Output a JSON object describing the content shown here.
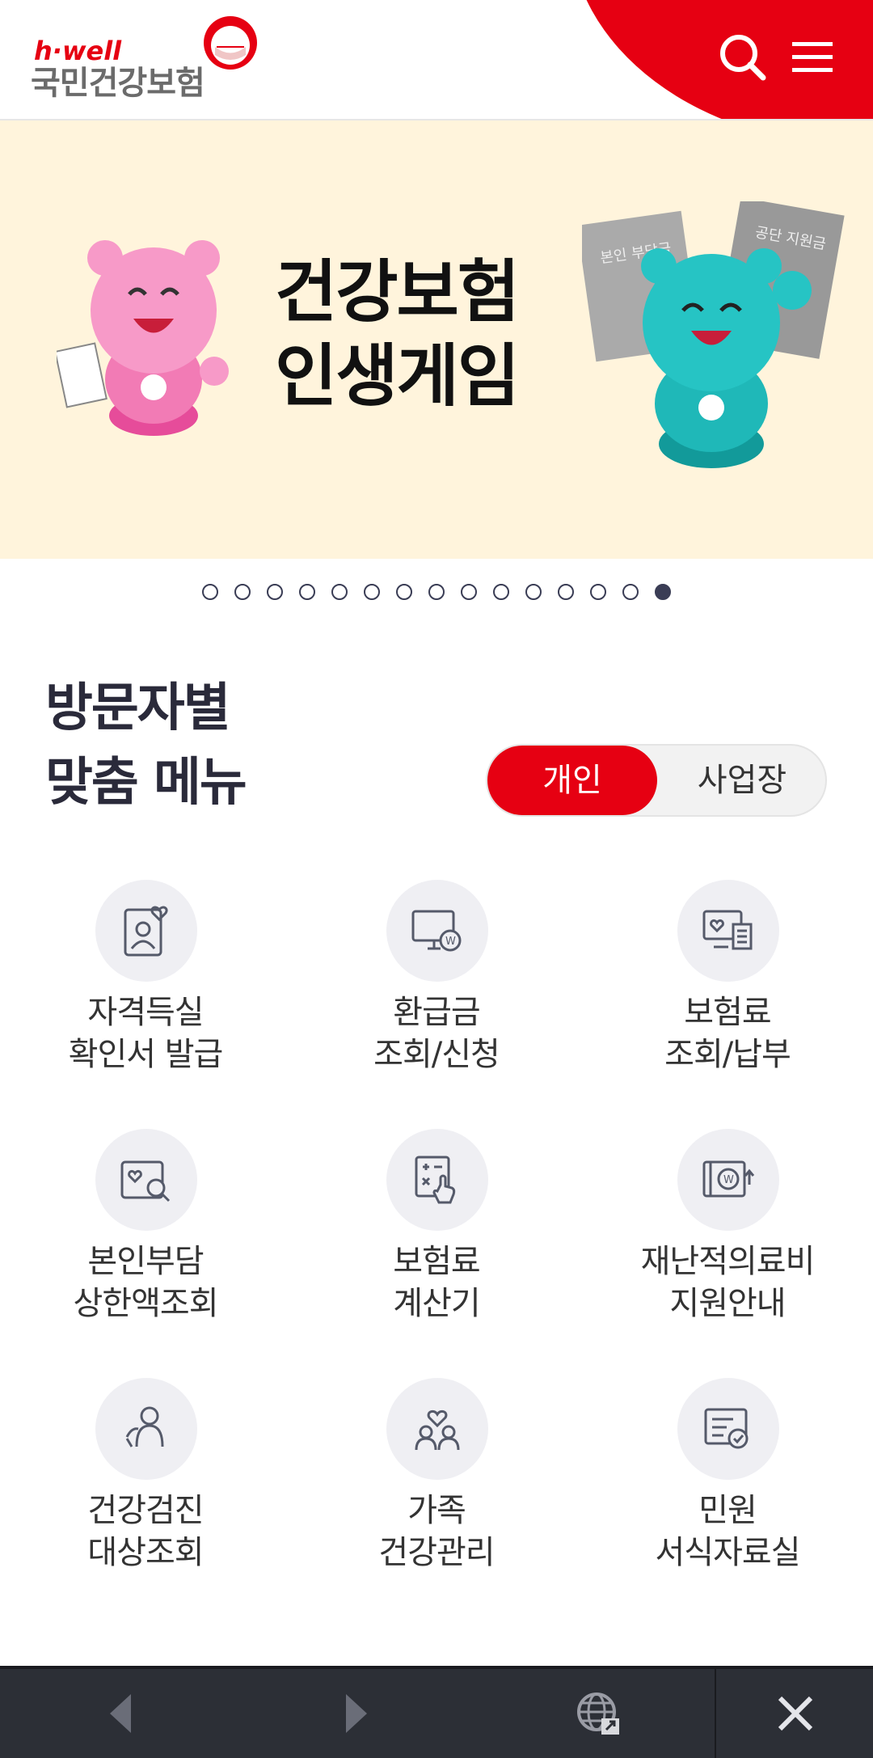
{
  "header": {
    "logo_sub": "h·well",
    "logo_name": "국민건강보험",
    "search_icon": "search-icon",
    "menu_icon": "hamburger-menu-icon",
    "accent_color": "#e60012"
  },
  "banner": {
    "title_line1": "건강보험",
    "title_line2": "인생게임",
    "card_left": "본인 부담금",
    "card_right": "공단 지원금",
    "background": "#fff4dc"
  },
  "carousel": {
    "total_slides": 15,
    "active_slide": 15
  },
  "section": {
    "title_line1": "방문자별",
    "title_line2": "맞춤 메뉴",
    "toggle": {
      "selected": "개인",
      "other": "사업장"
    }
  },
  "menu": [
    {
      "line1": "자격득실",
      "line2": "확인서 발급",
      "icon": "id-card-heart-icon"
    },
    {
      "line1": "환급금",
      "line2": "조회/신청",
      "icon": "monitor-won-icon"
    },
    {
      "line1": "보험료",
      "line2": "조회/납부",
      "icon": "monitor-receipt-icon"
    },
    {
      "line1": "본인부담",
      "line2": "상한액조회",
      "icon": "heart-search-icon"
    },
    {
      "line1": "보험료",
      "line2": "계산기",
      "icon": "calculator-icon"
    },
    {
      "line1": "재난적의료비",
      "line2": "지원안내",
      "icon": "won-support-icon"
    },
    {
      "line1": "건강검진",
      "line2": "대상조회",
      "icon": "person-health-icon"
    },
    {
      "line1": "가족",
      "line2": "건강관리",
      "icon": "family-heart-icon"
    },
    {
      "line1": "민원",
      "line2": "서식자료실",
      "icon": "document-check-icon"
    }
  ],
  "bottom_bar": {
    "back_icon": "back-arrow-icon",
    "forward_icon": "forward-arrow-icon",
    "globe_icon": "globe-icon",
    "close_icon": "close-icon"
  }
}
